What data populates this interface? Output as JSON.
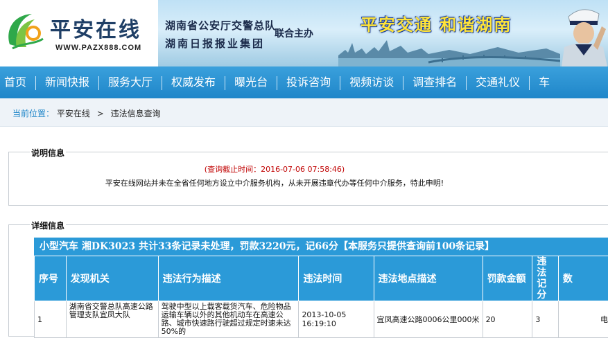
{
  "header": {
    "logo_text": "平安在线",
    "logo_url": "WWW.PAZX888.COM",
    "org_line1": "湖南省公安厅交警总队",
    "org_line2": "湖南日报报业集团",
    "joint_label": "联合主办",
    "slogan": "平安交通 和谐湖南"
  },
  "nav": {
    "items": [
      "首页",
      "新闻快报",
      "服务大厅",
      "权威发布",
      "曝光台",
      "投诉咨询",
      "视频访谈",
      "调查排名",
      "交通礼仪",
      "车"
    ]
  },
  "breadcrumb": {
    "label": "当前位置：",
    "items": [
      "平安在线",
      "违法信息查询"
    ]
  },
  "notice": {
    "legend": "说明信息",
    "query_time": "(查询截止时间：2016-07-06 07:58:46)",
    "disclaimer": "平安在线网站并未在全省任何地方设立中介服务机构，从未开展违章代办等任何中介服务，特此申明!"
  },
  "details": {
    "legend": "详细信息",
    "summary": "小型汽车 湘DK3023  共计33条记录未处理，罚款3220元，记66分【本服务只提供查询前100条记录】",
    "columns": [
      "序号",
      "发现机关",
      "违法行为描述",
      "违法时间",
      "违法地点描述",
      "罚款金额",
      "违法记分",
      "数"
    ],
    "rows": [
      {
        "index": "1",
        "agency": "湖南省交警总队高速公路管理支队宜凤大队",
        "behavior": "驾驶中型以上载客载货汽车、危险物品运输车辆以外的其他机动车在高速公路、城市快速路行驶超过规定时速未达50%的",
        "time": "2013-10-05 16:19:10",
        "location": "宜凤高速公路0006公里000米",
        "fine": "20",
        "points": "3",
        "data_source": "电子"
      }
    ]
  },
  "colors": {
    "nav_bg": "#1f86c9",
    "table_header_bg": "#2b9ad8",
    "notice_time": "#c00000",
    "breadcrumb_label": "#1f86c9"
  }
}
